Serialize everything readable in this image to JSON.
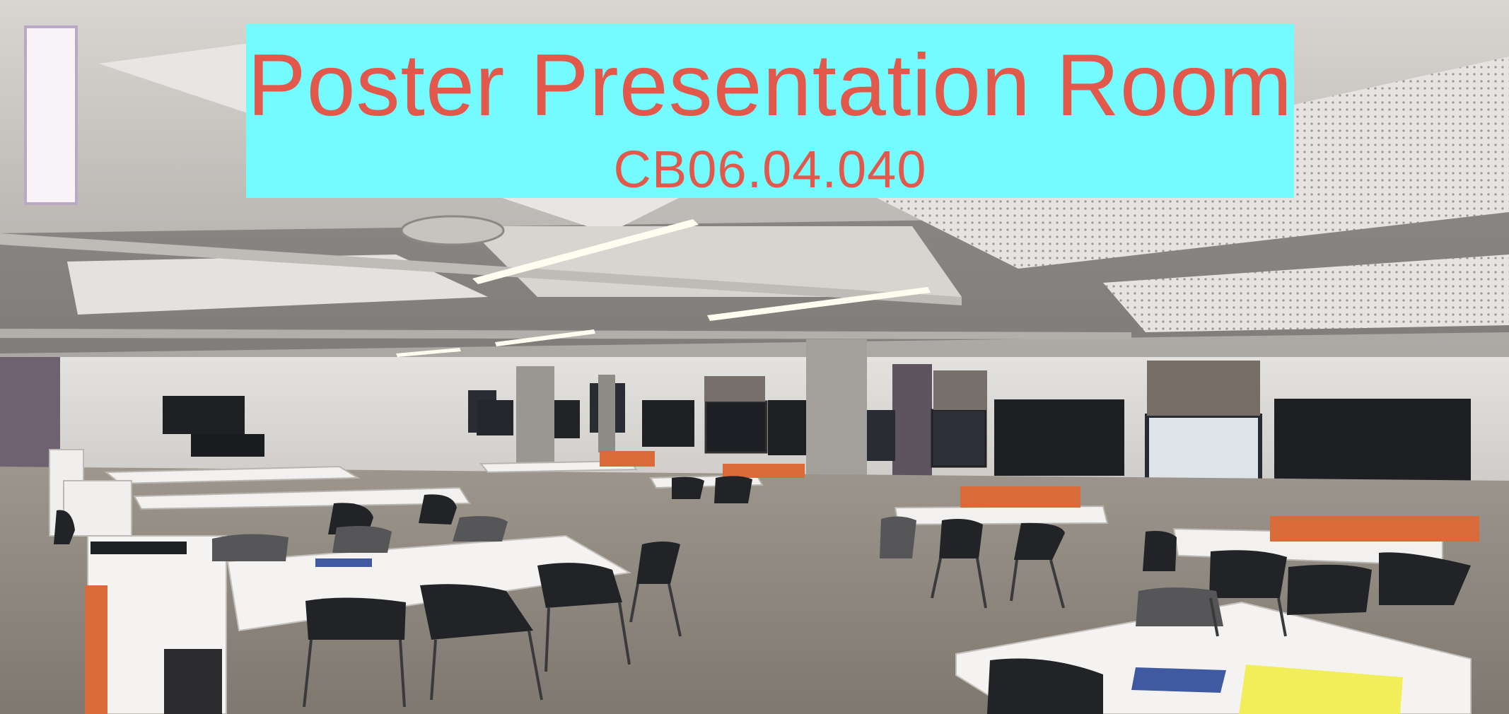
{
  "banner": {
    "title": "Poster Presentation Room",
    "room_code": "CB06.04.040",
    "background_color": "#74fbff",
    "text_color": "#e2584b"
  }
}
